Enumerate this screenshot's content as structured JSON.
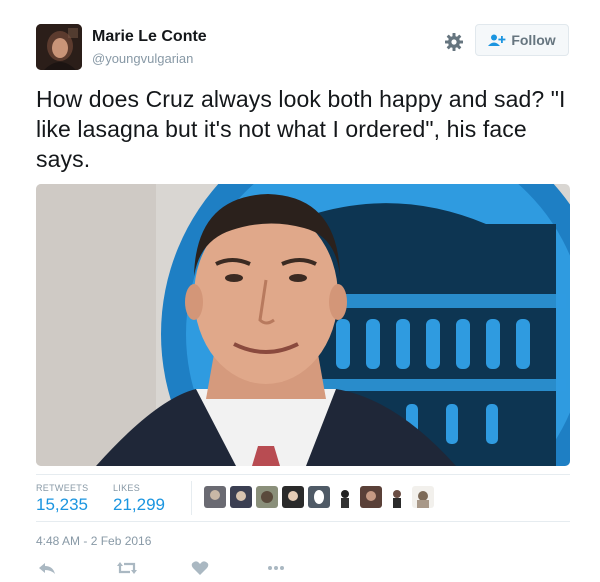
{
  "tweet": {
    "author_name": "Marie Le Conte",
    "author_handle": "@youngvulgarian",
    "follow_label": "Follow",
    "text": "How does Cruz always look both happy and sad? \"I like lasagna but it's not what I ordered\", his face says.",
    "retweets_label": "RETWEETS",
    "retweets_count": "15,235",
    "likes_label": "LIKES",
    "likes_count": "21,299",
    "timestamp": "4:48 AM - 2 Feb 2016"
  },
  "icons": {
    "settings": "gear-icon",
    "follow": "person-plus-icon",
    "reply": "reply-icon",
    "retweet": "retweet-icon",
    "like": "heart-icon",
    "more": "more-dots-icon"
  },
  "colors": {
    "link_blue": "#1b95e0",
    "muted_gray": "#8899a6",
    "text": "#14171a"
  }
}
